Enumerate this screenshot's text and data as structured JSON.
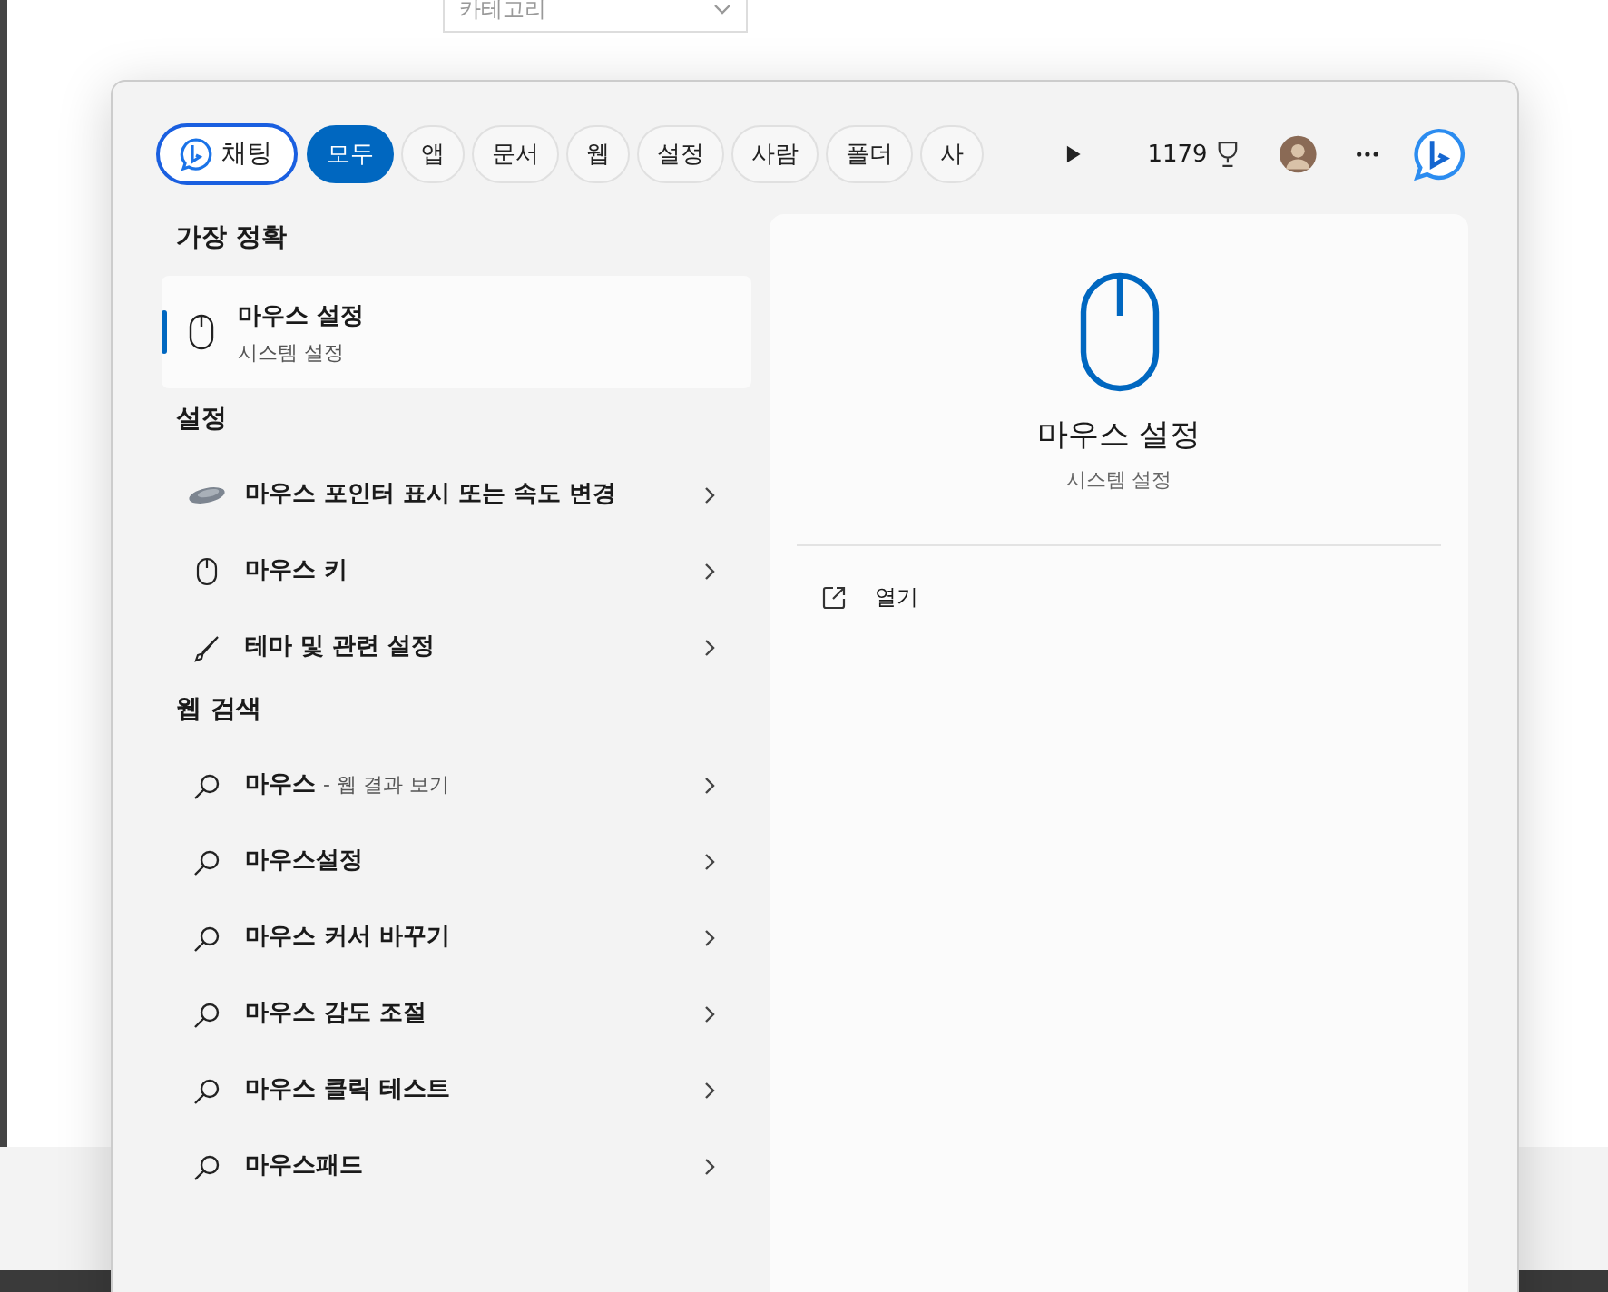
{
  "background": {
    "category_dropdown": {
      "value": "카테고리"
    }
  },
  "chat_button": {
    "label": "채팅"
  },
  "tabs": [
    {
      "label": "모두",
      "selected": true
    },
    {
      "label": "앱",
      "selected": false
    },
    {
      "label": "문서",
      "selected": false
    },
    {
      "label": "웹",
      "selected": false
    },
    {
      "label": "설정",
      "selected": false
    },
    {
      "label": "사람",
      "selected": false
    },
    {
      "label": "폴더",
      "selected": false
    },
    {
      "label": "사",
      "selected": false
    }
  ],
  "points": "1179",
  "best_match": {
    "heading": "가장 정확",
    "title": "마우스 설정",
    "subtitle": "시스템 설정",
    "selected": true
  },
  "sections": [
    {
      "heading": "설정",
      "items": [
        {
          "kind": "device",
          "title": "마우스 포인터 표시 또는 속도 변경"
        },
        {
          "kind": "mouse",
          "title": "마우스 키"
        },
        {
          "kind": "brush",
          "title": "테마 및 관련 설정"
        }
      ]
    },
    {
      "heading": "웹 검색",
      "items": [
        {
          "kind": "search",
          "title": "마우스",
          "suffix": "- 웹 결과 보기"
        },
        {
          "kind": "search",
          "title": "마우스설정"
        },
        {
          "kind": "search",
          "title": "마우스 커서 바꾸기"
        },
        {
          "kind": "search",
          "title": "마우스 감도 조절"
        },
        {
          "kind": "search",
          "title": "마우스 클릭 테스트"
        },
        {
          "kind": "search",
          "title": "마우스패드"
        }
      ]
    }
  ],
  "preview": {
    "title": "마우스 설정",
    "subtitle": "시스템 설정",
    "actions": [
      {
        "label": "열기"
      }
    ]
  }
}
